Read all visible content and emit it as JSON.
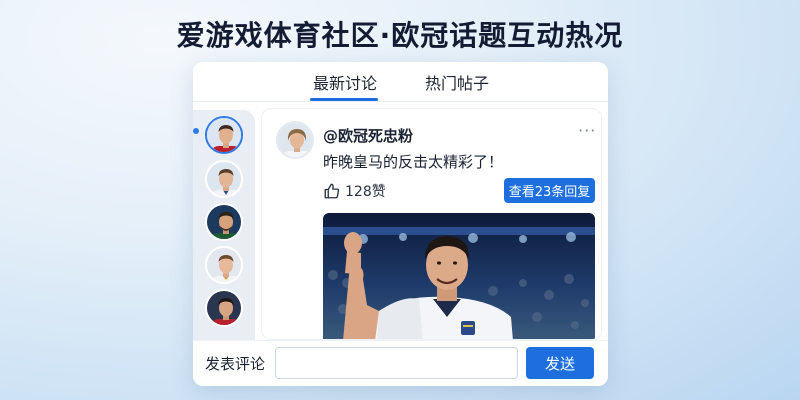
{
  "page": {
    "title": "爱游戏体育社区·欧冠话题互动热况"
  },
  "tabs": [
    {
      "label": "最新讨论",
      "active": true
    },
    {
      "label": "热门帖子",
      "active": false
    }
  ],
  "rail": {
    "avatars": [
      {
        "name": "player-avatar",
        "jersey": "#b8202c",
        "active": true
      },
      {
        "name": "player-avatar",
        "jersey": "#f2f4f7",
        "active": false
      },
      {
        "name": "player-avatar",
        "jersey": "#1d5a34",
        "active": false
      },
      {
        "name": "player-avatar",
        "jersey": "#f2f4f7",
        "active": false
      },
      {
        "name": "player-avatar",
        "jersey": "#b8202c",
        "active": false
      }
    ]
  },
  "post": {
    "author": "@欧冠死忠粉",
    "more": "···",
    "text": "昨晚皇马的反击太精彩了！",
    "like_icon": "thumbs-up-icon",
    "likes": "128赞",
    "reply_label": "查看23条回复",
    "image": "player-celebration-photo"
  },
  "comment": {
    "label": "发表评论",
    "placeholder": "",
    "value": "",
    "send_label": "发送"
  },
  "colors": {
    "accent": "#1d6fe0",
    "background": "#cfe3f5"
  }
}
